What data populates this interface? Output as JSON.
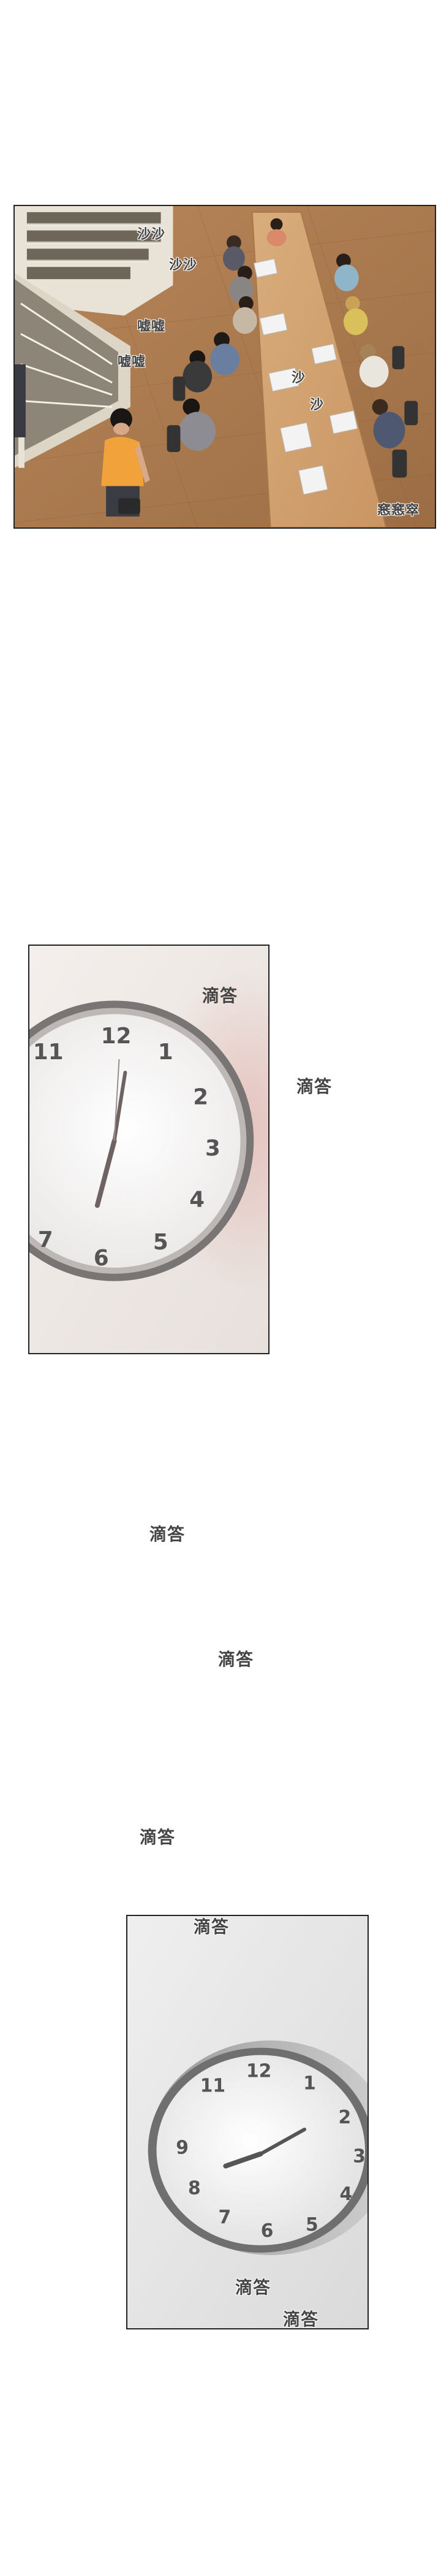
{
  "panel1": {
    "sfx": [
      "沙沙",
      "沙沙",
      "嘘嘘",
      "嘘嘘",
      "沙",
      "沙",
      "窸窸窣"
    ]
  },
  "panel2": {
    "sfx": "滴答",
    "clock_numbers": [
      "12",
      "1",
      "2",
      "3",
      "4",
      "5",
      "6",
      "7",
      "11"
    ]
  },
  "outside_sfx": [
    "滴答",
    "滴答",
    "滴答",
    "滴答"
  ],
  "panel3": {
    "sfx": [
      "滴答",
      "滴答",
      "滴答"
    ],
    "clock_numbers": [
      "12",
      "1",
      "2",
      "3",
      "4",
      "5",
      "6",
      "7",
      "8",
      "9",
      "11"
    ]
  }
}
